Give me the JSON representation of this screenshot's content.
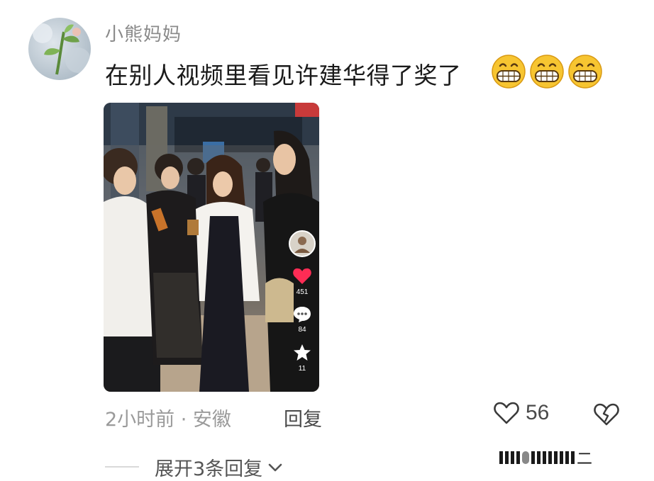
{
  "comment": {
    "username": "小熊妈妈",
    "text": "在别人视频里看见许建华得了奖了",
    "emoji": [
      "grinning-face",
      "grinning-face",
      "grinning-face"
    ]
  },
  "video": {
    "likes": "451",
    "comments": "84",
    "favorites": "11"
  },
  "meta": {
    "time_location": "2小时前 · 安徽",
    "reply_label": "回复",
    "like_count": "56"
  },
  "replies": {
    "expand_label": "展开3条回复"
  },
  "watermark": {
    "text": "二"
  },
  "colors": {
    "like_heart": "#fe2c55",
    "text_primary": "#1a1a1a",
    "text_secondary": "#9a9a9a"
  }
}
